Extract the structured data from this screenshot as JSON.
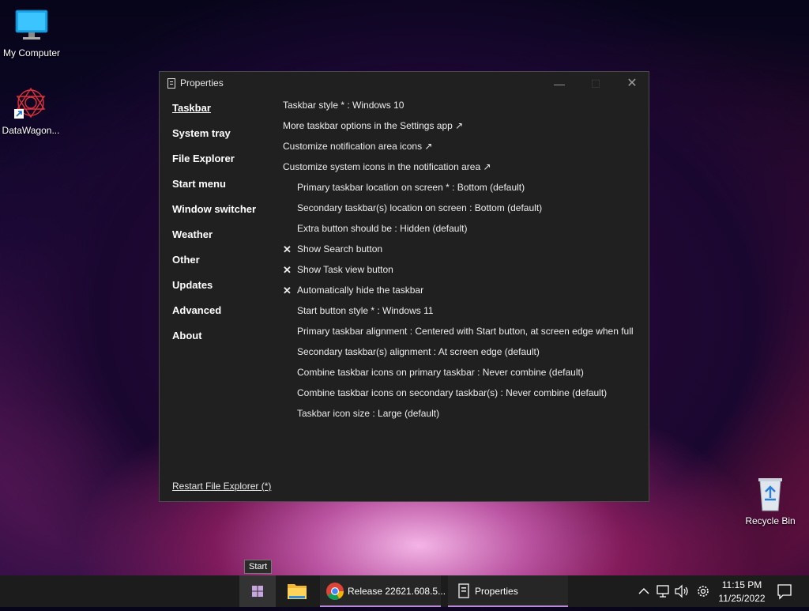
{
  "desktop": {
    "icons": [
      {
        "label": "My Computer",
        "icon": "monitor-icon"
      },
      {
        "label": "DataWagon...",
        "icon": "datawagon-icon"
      },
      {
        "label": "Recycle Bin",
        "icon": "recycle-bin-icon"
      }
    ]
  },
  "window": {
    "title": "Properties",
    "nav": [
      {
        "label": "Taskbar",
        "active": true
      },
      {
        "label": "System tray"
      },
      {
        "label": "File Explorer"
      },
      {
        "label": "Start menu"
      },
      {
        "label": "Window switcher"
      },
      {
        "label": "Weather"
      },
      {
        "label": "Other"
      },
      {
        "label": "Updates"
      },
      {
        "label": "Advanced"
      },
      {
        "label": "About"
      }
    ],
    "restart_link": "Restart File Explorer (*)",
    "settings": [
      {
        "text": "Taskbar style * : Windows 10",
        "indent": false
      },
      {
        "text": "More taskbar options in the Settings app ↗",
        "indent": false
      },
      {
        "text": "Customize notification area icons ↗",
        "indent": false
      },
      {
        "text": "Customize system icons in the notification area ↗",
        "indent": false
      },
      {
        "text": "Primary taskbar location on screen * : Bottom (default)",
        "indent": true
      },
      {
        "text": "Secondary taskbar(s) location on screen : Bottom (default)",
        "indent": true
      },
      {
        "text": "Extra button should be : Hidden (default)",
        "indent": true
      },
      {
        "text": "Show Search button",
        "indent": true,
        "mark": "✕"
      },
      {
        "text": "Show Task view button",
        "indent": true,
        "mark": "✕"
      },
      {
        "text": "Automatically hide the taskbar",
        "indent": true,
        "mark": "✕"
      },
      {
        "text": "Start button style * : Windows 11",
        "indent": true
      },
      {
        "text": "Primary taskbar alignment : Centered with Start button, at screen edge when full",
        "indent": true
      },
      {
        "text": "Secondary taskbar(s) alignment : At screen edge (default)",
        "indent": true
      },
      {
        "text": "Combine taskbar icons on primary taskbar : Never combine (default)",
        "indent": true
      },
      {
        "text": "Combine taskbar icons on secondary taskbar(s) : Never combine (default)",
        "indent": true
      },
      {
        "text": "Taskbar icon size : Large (default)",
        "indent": true
      }
    ]
  },
  "taskbar": {
    "tooltip": "Start",
    "chrome_label": "Release 22621.608.5...",
    "properties_label": "Properties",
    "time": "11:15 PM",
    "date": "11/25/2022",
    "accent": "#b88ad6"
  }
}
